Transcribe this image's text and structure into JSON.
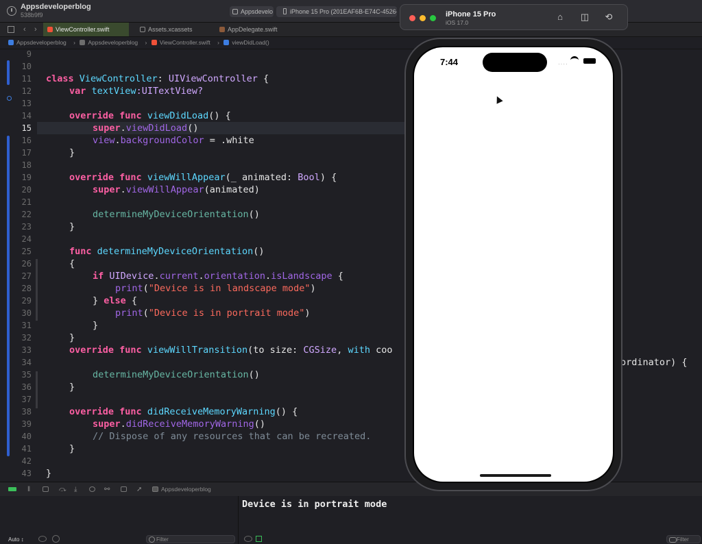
{
  "titlebar": {
    "project_name": "Appsdeveloperblog",
    "project_hash": "538b9f9",
    "scheme_app": "Appsdevelo",
    "scheme_device": "iPhone 15 Pro (201EAF6B-E74C-4526-"
  },
  "tabs": [
    {
      "label": "ViewController.swift",
      "active": true
    },
    {
      "label": "Assets.xcassets",
      "active": false
    },
    {
      "label": "AppDelegate.swift",
      "active": false
    }
  ],
  "breadcrumb": [
    "Appsdeveloperblog",
    "Appsdeveloperblog",
    "ViewController.swift",
    "viewDidLoad()"
  ],
  "code": {
    "current_line": "15",
    "lines": [
      {
        "n": "9"
      },
      {
        "n": "10"
      },
      {
        "n": "11"
      },
      {
        "n": "12"
      },
      {
        "n": "13"
      },
      {
        "n": "14"
      },
      {
        "n": "15"
      },
      {
        "n": "16"
      },
      {
        "n": "17"
      },
      {
        "n": "18"
      },
      {
        "n": "19"
      },
      {
        "n": "20"
      },
      {
        "n": "21"
      },
      {
        "n": "22"
      },
      {
        "n": "23"
      },
      {
        "n": "24"
      },
      {
        "n": "25"
      },
      {
        "n": "26"
      },
      {
        "n": "27"
      },
      {
        "n": "28"
      },
      {
        "n": "29"
      },
      {
        "n": "30"
      },
      {
        "n": "31"
      },
      {
        "n": "32"
      },
      {
        "n": "33"
      },
      {
        "n": "34"
      },
      {
        "n": "35"
      },
      {
        "n": "36"
      },
      {
        "n": "37"
      },
      {
        "n": "38"
      },
      {
        "n": "39"
      },
      {
        "n": "40"
      },
      {
        "n": "41"
      },
      {
        "n": "42"
      },
      {
        "n": "43"
      }
    ],
    "t": {
      "class": "class",
      "ViewController": "ViewController",
      "colon": ": ",
      "UIViewController": "UIViewController",
      "brace_open": " {",
      "var": "var",
      "textView": "textView",
      "textview_type": ":UITextView?",
      "override": "override",
      "func": "func",
      "viewDidLoad": "viewDidLoad",
      "paren_brace": "() {",
      "super": "super",
      "dot": ".",
      "parens": "()",
      "view": "view",
      "backgroundColor": "backgroundColor",
      "assign_white": " = .white",
      "close": "}",
      "viewWillAppear": "viewWillAppear",
      "animated_sig": "(_ animated: ",
      "Bool": "Bool",
      "paren_close_brace": ") {",
      "animated_call": "(animated)",
      "determineMyDeviceOrientation": "determineMyDeviceOrientation",
      "open": "{",
      "if": "if",
      "UIDevice": "UIDevice",
      "current": "current",
      "orientation": "orientation",
      "isLandscape": "isLandscape",
      "print": "print",
      "landscape_str": "\"Device is in landscape mode\"",
      "paren_open": "(",
      "paren_close": ")",
      "else_close": "} ",
      "else": "else",
      "portrait_str": "\"Device is in portrait mode\"",
      "viewWillTransition": "viewWillTransition",
      "to_size": "(to size: ",
      "CGSize": "CGSize",
      "comma": ", ",
      "with": "with",
      "coo": " coo",
      "ordinator_tail": "ordinator) {",
      "didReceiveMemoryWarning": "didReceiveMemoryWarning",
      "comment": "// Dispose of any resources that can be recreated."
    }
  },
  "debugbar": {
    "target": "Appsdeveloperblog"
  },
  "console": {
    "output": "Device is in portrait mode",
    "auto_label": "Auto ↕",
    "filter_placeholder": "Filter",
    "filter_placeholder_right": "Filter"
  },
  "simulator": {
    "device": "iPhone 15 Pro",
    "os": "iOS 17.0",
    "time": "7:44"
  },
  "colors": {
    "close": "#ff5f57",
    "minimize": "#febc2e",
    "zoom": "#28c840",
    "accent": "#2f5fd0"
  }
}
